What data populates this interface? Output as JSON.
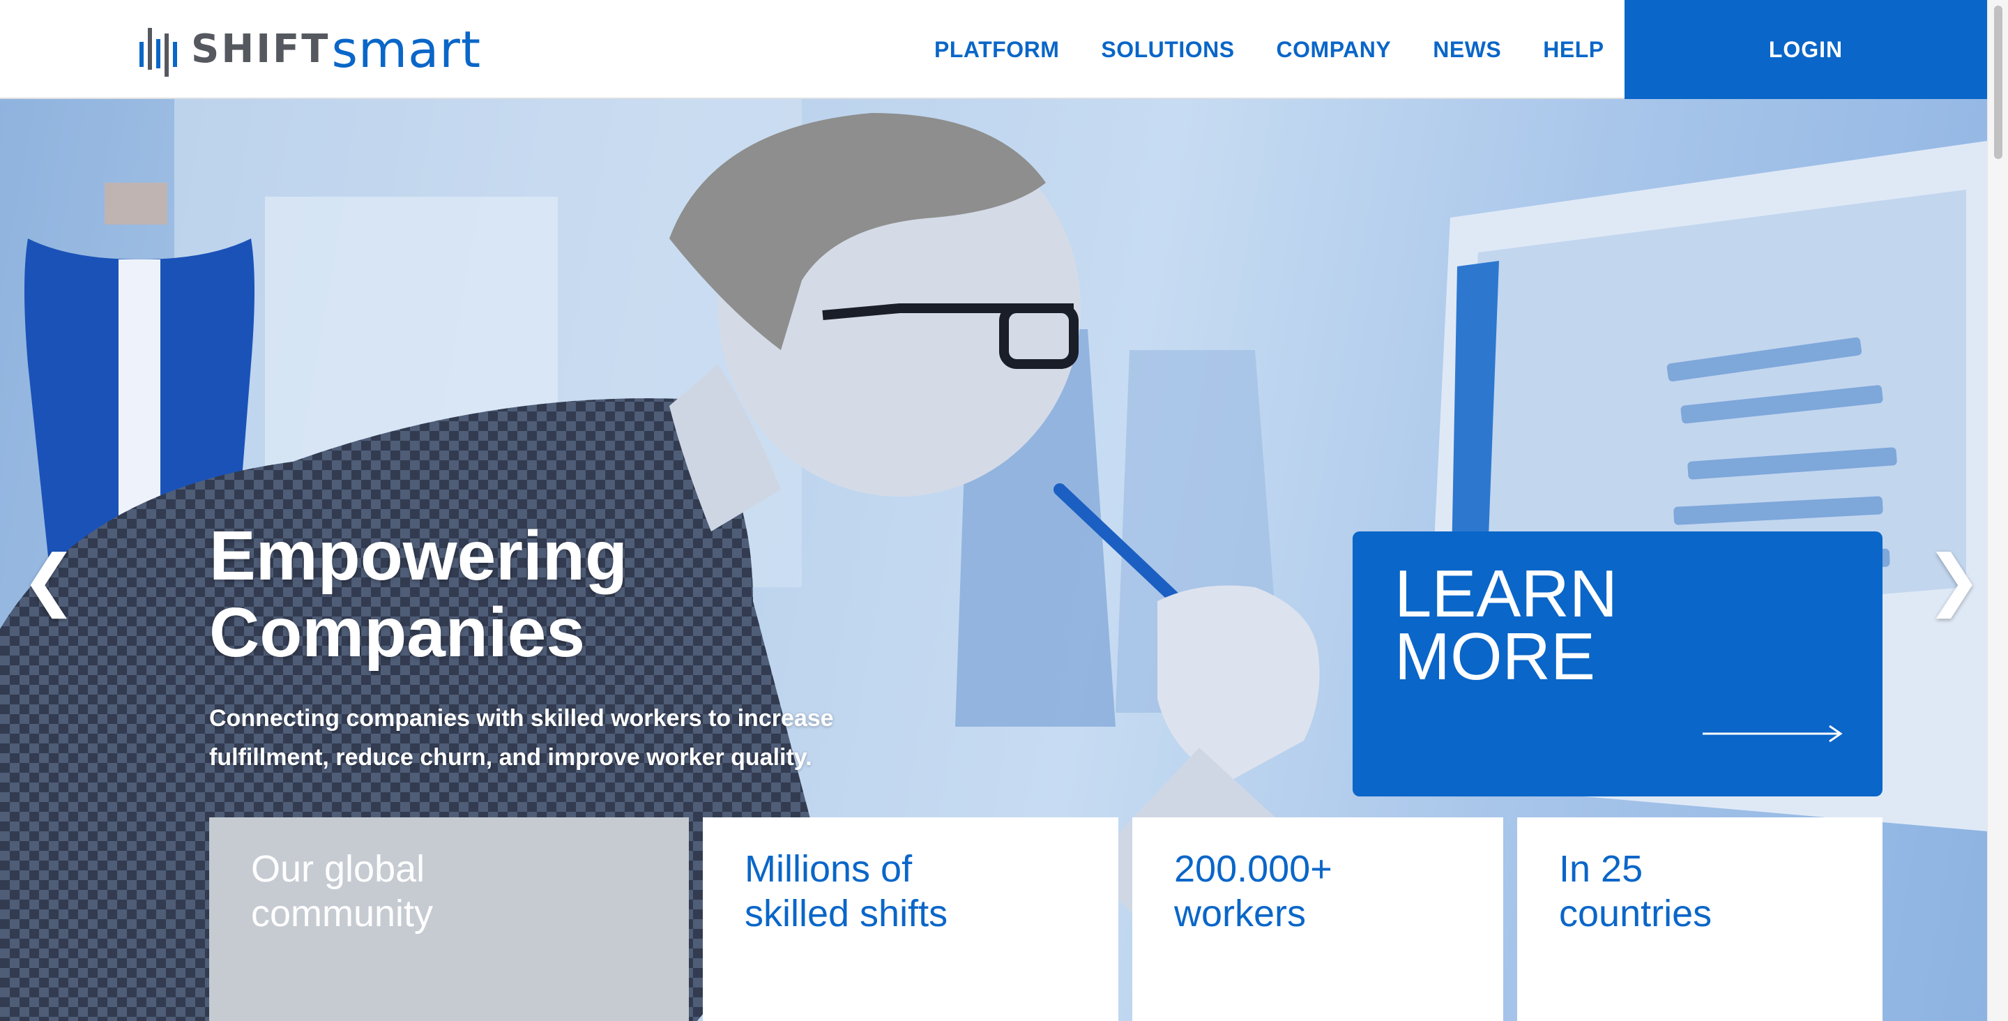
{
  "header": {
    "logo": {
      "shift": "SHIFT",
      "smart": "smart"
    },
    "nav": [
      "PLATFORM",
      "SOLUTIONS",
      "COMPANY",
      "NEWS",
      "HELP"
    ],
    "login_label": "LOGIN"
  },
  "hero": {
    "title_line1": "Empowering",
    "title_line2": "Companies",
    "subtitle": "Connecting companies with skilled workers to increase fulfillment, reduce churn, and improve worker quality.",
    "prev_arrow": "❮",
    "next_arrow": "❯",
    "learn_more_line1": "LEARN",
    "learn_more_line2": "MORE"
  },
  "stats": [
    {
      "line1": "Our global",
      "line2": "community"
    },
    {
      "line1": "Millions of",
      "line2": "skilled shifts"
    },
    {
      "line1": "200.000+",
      "line2": "workers"
    },
    {
      "line1": "In 25",
      "line2": "countries"
    }
  ],
  "colors": {
    "brand_blue": "#0a66c8",
    "logo_gray": "#55595f",
    "card_gray": "#c6cbd2"
  }
}
